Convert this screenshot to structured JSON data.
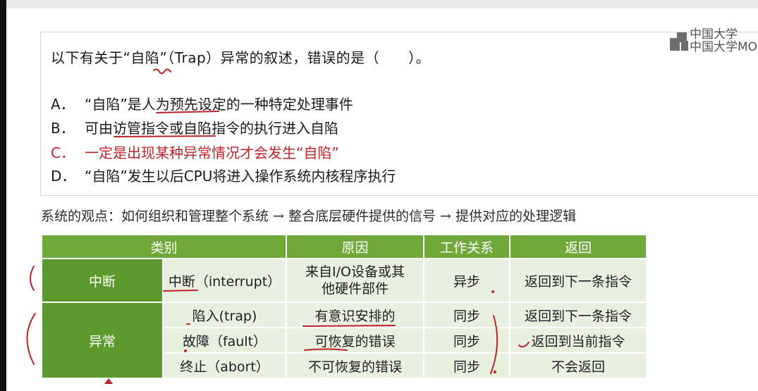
{
  "question": {
    "stem": "以下有关于“自陷”（Trap）异常的叙述，错误的是（　　）。",
    "options": [
      {
        "letter": "A．",
        "text": "“自陷”是人为预先设定的一种特定处理事件"
      },
      {
        "letter": "B．",
        "text": "可由访管指令或自陷指令的执行进入自陷"
      },
      {
        "letter": "C．",
        "text": "一定是出现某种异常情况才会发生“自陷”"
      },
      {
        "letter": "D．",
        "text": "“自陷”发生以后CPU将进入操作系统内核程序执行"
      }
    ],
    "correct_color": "#c0222a"
  },
  "logo": {
    "line1": "中国大学",
    "line2": "中国大学MO"
  },
  "viewpoint": "系统的观点：如何组织和管理整个系统 → 整合底层硬件提供的信号 → 提供对应的处理逻辑",
  "table": {
    "headers": [
      "类别",
      "原因",
      "工作关系",
      "返回"
    ],
    "interrupt": {
      "category": "中断",
      "name": "中断（interrupt）",
      "cause_line1": "来自I/O设备或其",
      "cause_line2": "他硬件部件",
      "relation": "异步",
      "return": "返回到下一条指令"
    },
    "exception": {
      "category": "异常",
      "rows": [
        {
          "name": "陷入(trap)",
          "cause": "有意识安排的",
          "relation": "同步",
          "return": "返回到下一条指令"
        },
        {
          "name": "故障（fault）",
          "cause": "可恢复的错误",
          "relation": "同步",
          "return": "返回到当前指令"
        },
        {
          "name": "终止（abort）",
          "cause": "不可恢复的错误",
          "relation": "同步",
          "return": "不会返回"
        }
      ]
    },
    "colors": {
      "header": "#70a83a",
      "category": "#5c9a2e",
      "cell": "#e8f1e0"
    }
  },
  "ink_color": "#c0222a"
}
